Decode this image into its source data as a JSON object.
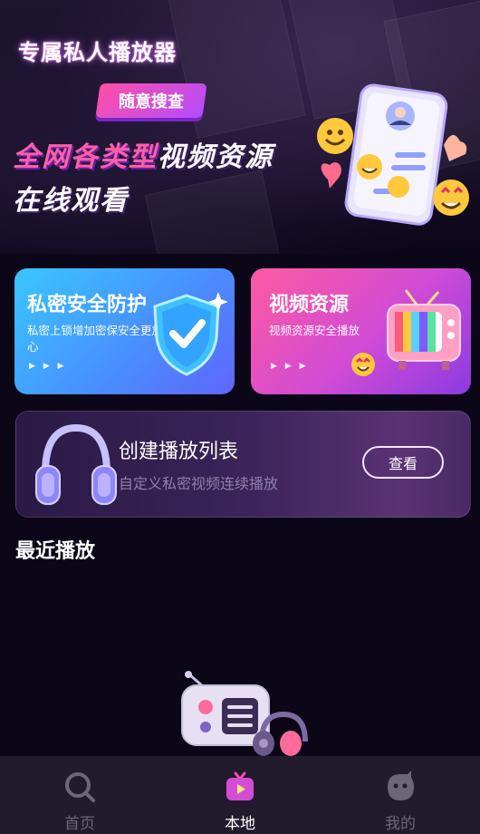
{
  "header": {
    "app_title": "专属私人播放器"
  },
  "banner": {
    "badge_label": "随意搜查",
    "headline_pink": "全网各类型",
    "headline_white": "视频资源",
    "headline_line2": "在线观看"
  },
  "features": [
    {
      "title": "私密安全防护",
      "desc": "私密上锁增加密保安全更放心",
      "icon": "shield-check-icon"
    },
    {
      "title": "视频资源",
      "desc": "视频资源安全播放",
      "icon": "retro-tv-icon"
    }
  ],
  "playlist": {
    "title": "创建播放列表",
    "subtitle": "自定义私密视频连续播放",
    "button_label": "查看",
    "icon": "headphones-icon"
  },
  "recent": {
    "title": "最近播放",
    "empty_icon": "radio-icon"
  },
  "tabs": [
    {
      "label": "首页",
      "icon": "search-icon",
      "active": false
    },
    {
      "label": "本地",
      "icon": "tv-play-icon",
      "active": true
    },
    {
      "label": "我的",
      "icon": "face-icon",
      "active": false
    }
  ],
  "colors": {
    "background": "#0b0618",
    "security_card": "#4a8cff",
    "video_card": "#d04bd6",
    "accent_pink": "#ff5fa8",
    "tabbar": "#221b2c"
  }
}
